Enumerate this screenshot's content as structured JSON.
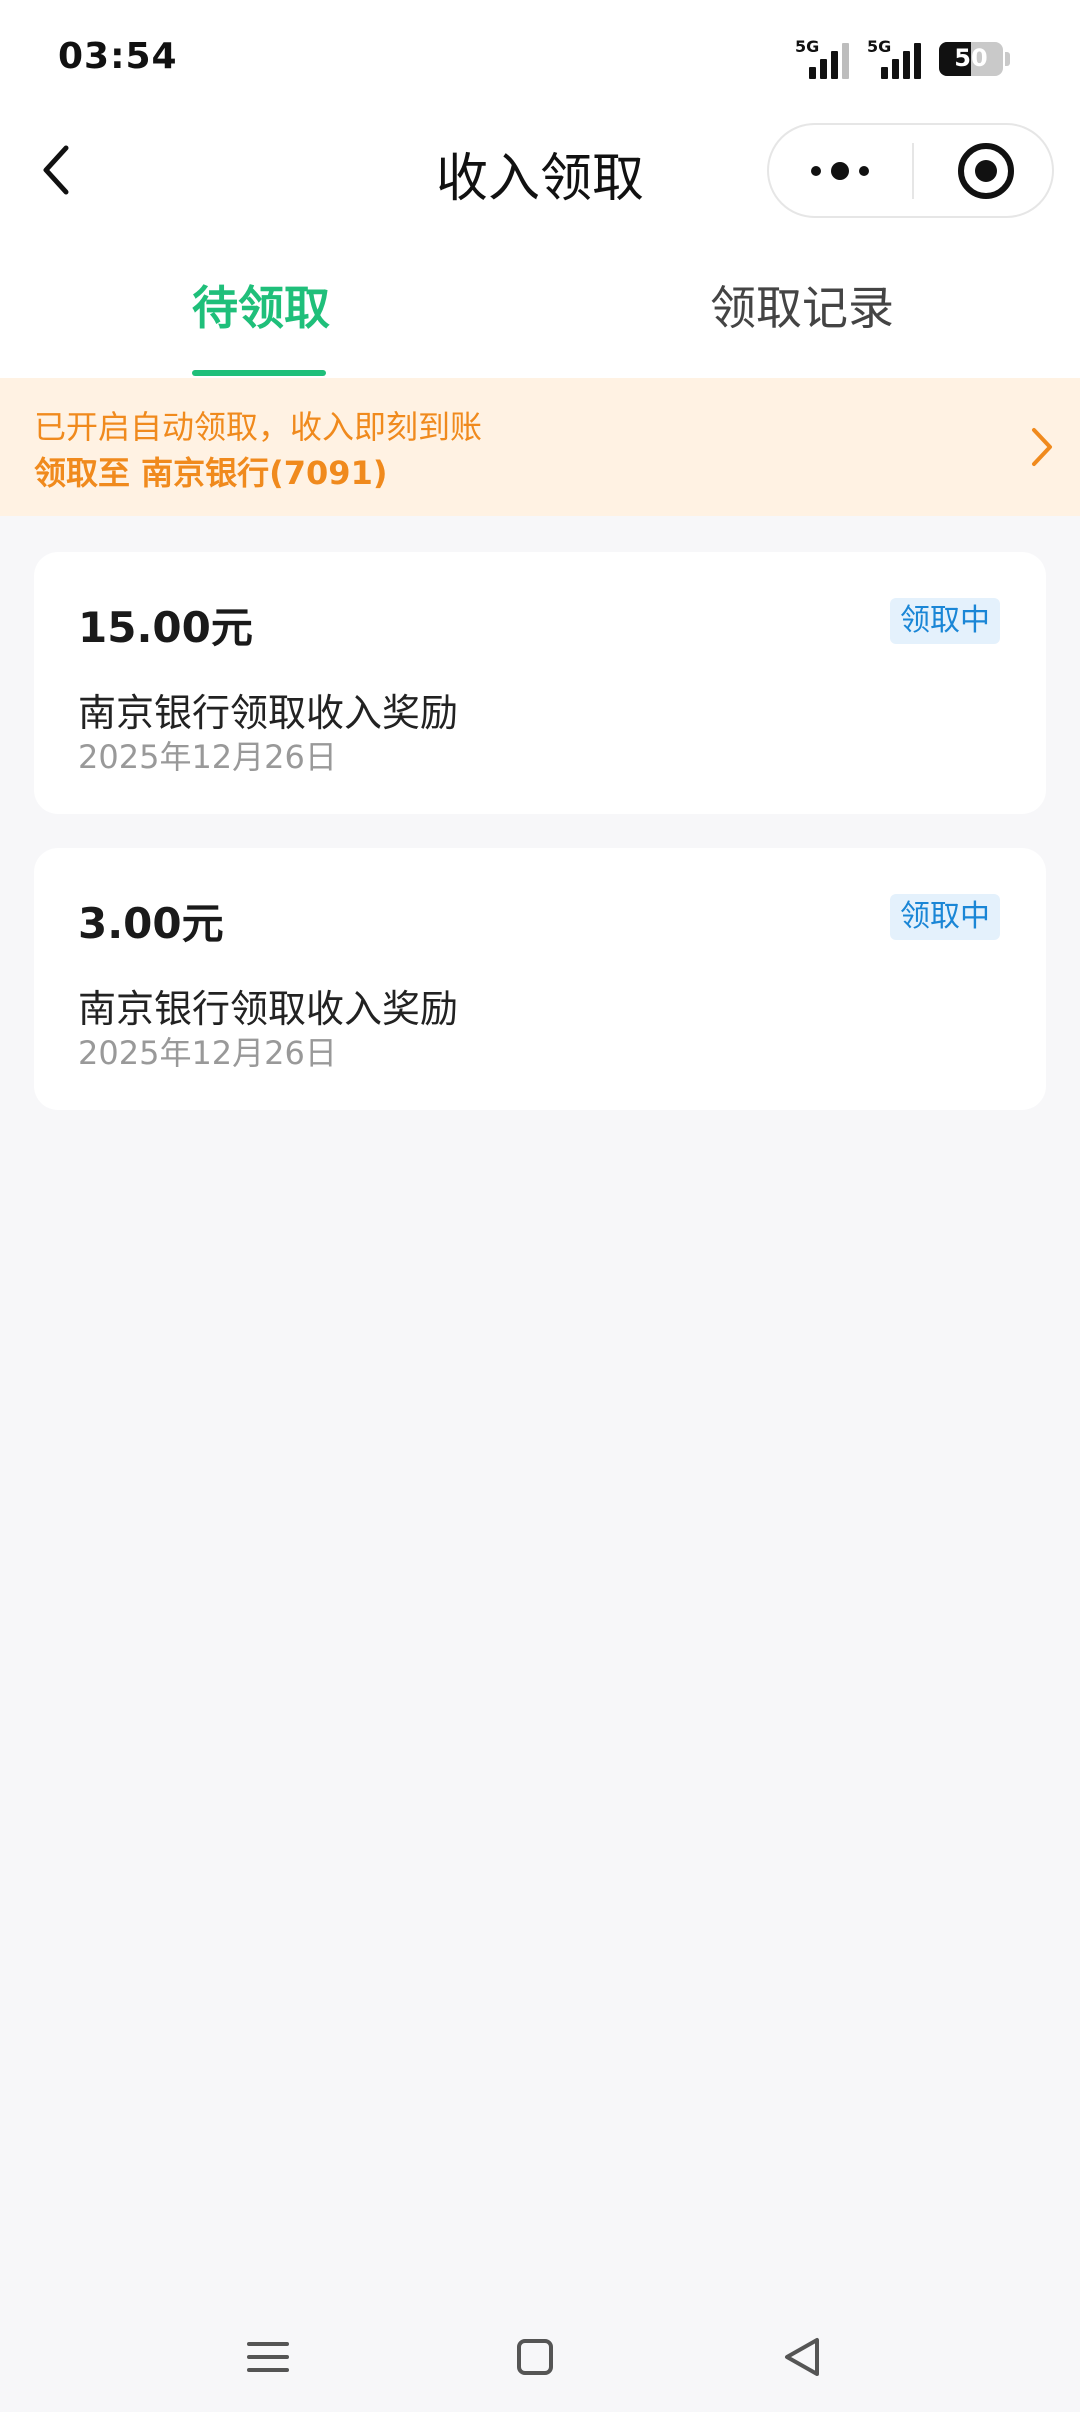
{
  "status_bar": {
    "time": "03:54",
    "signal1_label": "5G",
    "signal2_label": "5G",
    "battery_level": "50",
    "battery_fraction": 0.5
  },
  "nav": {
    "title": "收入领取",
    "back_icon": "chevron-left-icon",
    "more_icon": "more-dots-icon",
    "close_icon": "target-close-icon"
  },
  "tabs": [
    {
      "label": "待领取",
      "active": true
    },
    {
      "label": "领取记录",
      "active": false
    }
  ],
  "banner": {
    "line1": "已开启自动领取，收入即刻到账",
    "line2": "领取至 南京银行(7091)",
    "color": "#f08a1d",
    "background": "#fff2e3"
  },
  "records": [
    {
      "amount": "15.00元",
      "status": "领取中",
      "description": "南京银行领取收入奖励",
      "date": "2025年12月26日"
    },
    {
      "amount": "3.00元",
      "status": "领取中",
      "description": "南京银行领取收入奖励",
      "date": "2025年12月26日"
    }
  ],
  "colors": {
    "accent": "#1fbf7a",
    "badge_text": "#1a86d6",
    "badge_bg": "#e4f1fc"
  },
  "system_nav": [
    "menu-icon",
    "home-square-icon",
    "back-triangle-icon"
  ]
}
